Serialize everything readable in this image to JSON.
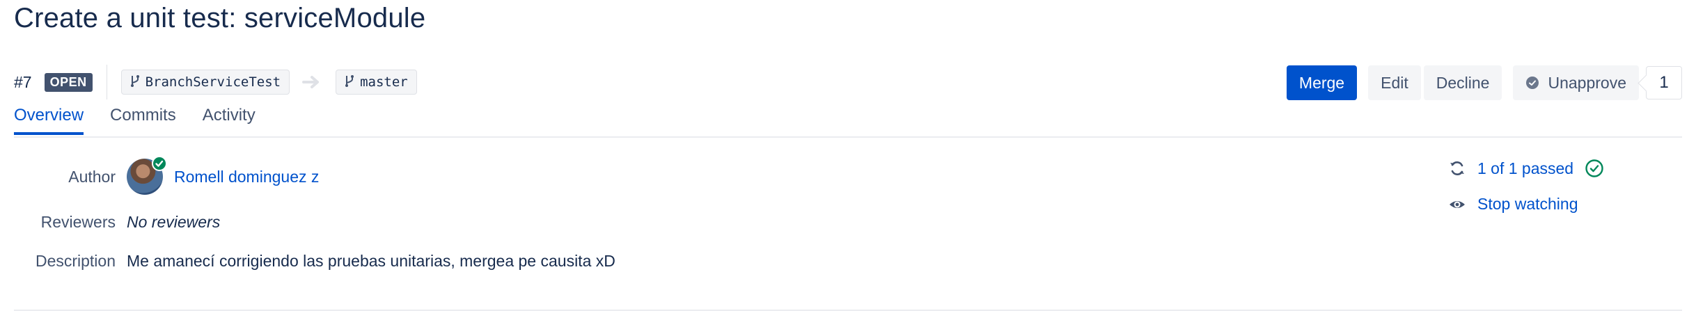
{
  "pull_request": {
    "title": "Create a unit test: serviceModule",
    "number": "#7",
    "status": "OPEN",
    "source_branch": "BranchServiceTest",
    "target_branch": "master"
  },
  "actions": {
    "merge_label": "Merge",
    "edit_label": "Edit",
    "decline_label": "Decline",
    "unapprove_label": "Unapprove",
    "approval_count": "1"
  },
  "tabs": [
    {
      "label": "Overview",
      "active": true
    },
    {
      "label": "Commits",
      "active": false
    },
    {
      "label": "Activity",
      "active": false
    }
  ],
  "details": {
    "author_label": "Author",
    "author_name": "Romell dominguez z",
    "reviewers_label": "Reviewers",
    "reviewers_value": "No reviewers",
    "description_label": "Description",
    "description_value": "Me amanecí corrigiendo las pruebas unitarias, mergea pe causita xD"
  },
  "side_panel": {
    "builds_label": "1 of 1 passed",
    "watch_label": "Stop watching"
  },
  "colors": {
    "primary": "#0052cc",
    "success": "#00875a",
    "badge": "#42526e",
    "text": "#172b4d"
  },
  "icons": [
    "branch-icon",
    "arrow-right-icon",
    "check-circle-icon",
    "sync-icon",
    "eye-icon"
  ]
}
